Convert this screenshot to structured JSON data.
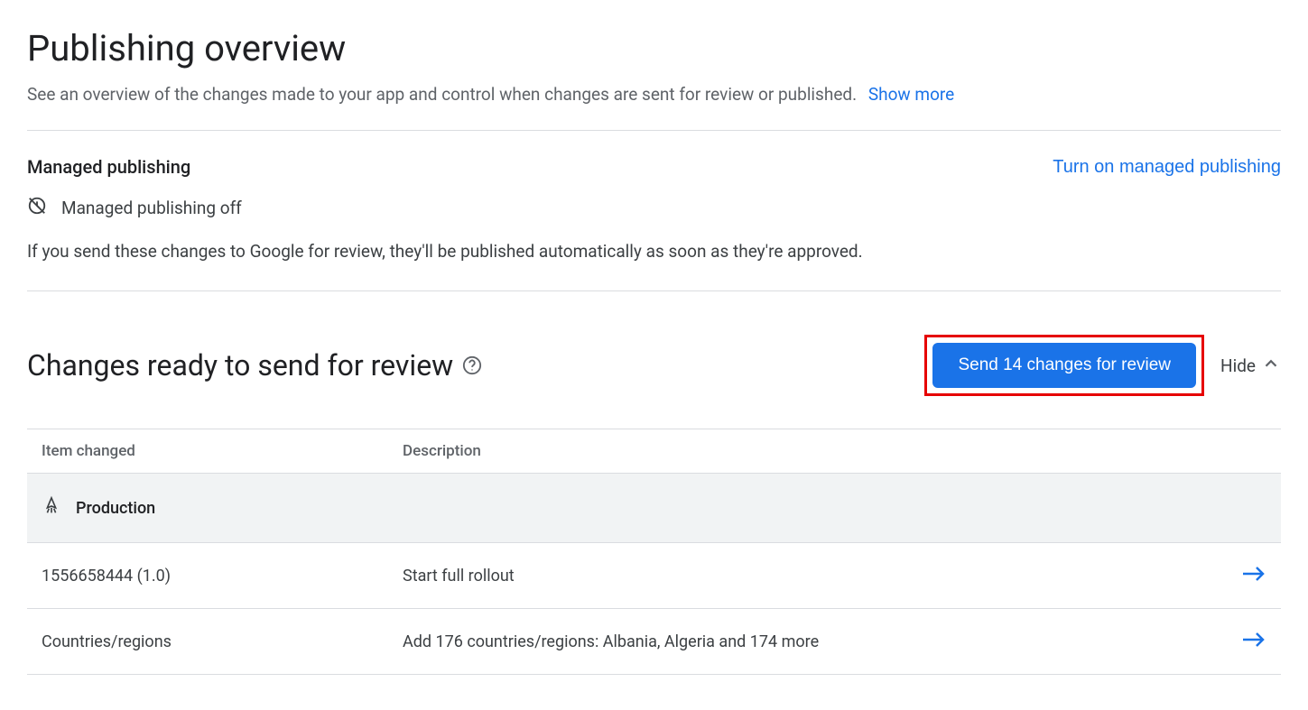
{
  "header": {
    "title": "Publishing overview",
    "subtitle": "See an overview of the changes made to your app and control when changes are sent for review or published.",
    "show_more": "Show more"
  },
  "managed_publishing": {
    "section_title": "Managed publishing",
    "turn_on_label": "Turn on managed publishing",
    "status_text": "Managed publishing off",
    "description": "If you send these changes to Google for review, they'll be published automatically as soon as they're approved."
  },
  "changes": {
    "title": "Changes ready to send for review",
    "send_button": "Send 14 changes for review",
    "hide_label": "Hide",
    "columns": {
      "item": "Item changed",
      "description": "Description"
    },
    "group_label": "Production",
    "rows": [
      {
        "item": "1556658444 (1.0)",
        "description": "Start full rollout"
      },
      {
        "item": "Countries/regions",
        "description": "Add 176 countries/regions: Albania, Algeria and 174 more"
      }
    ]
  }
}
